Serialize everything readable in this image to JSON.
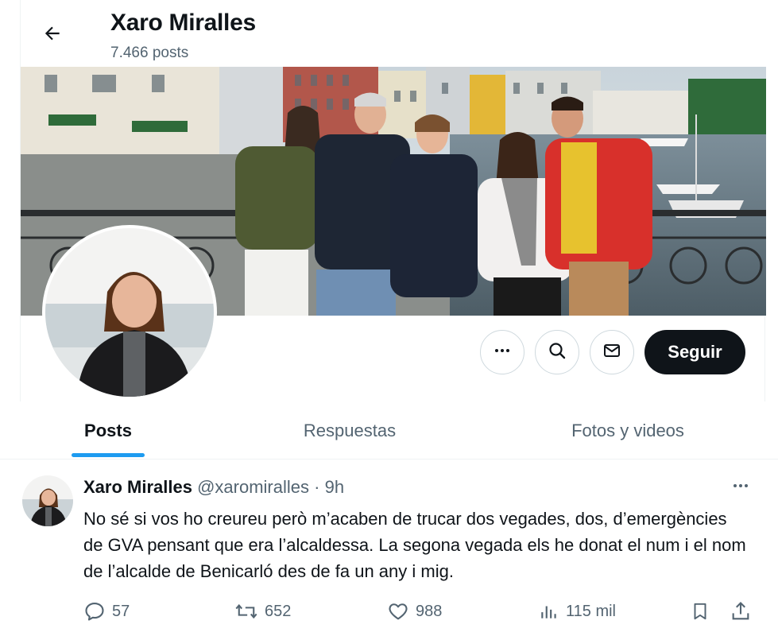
{
  "header": {
    "title": "Xaro Miralles",
    "posts_count": "7.466 posts"
  },
  "profile": {
    "follow_label": "Seguir",
    "icons": [
      "arrow-left-icon",
      "more-dots-icon",
      "search-icon",
      "mail-icon"
    ]
  },
  "tabs": [
    {
      "label": "Posts",
      "active": true
    },
    {
      "label": "Respuestas",
      "active": false
    },
    {
      "label": "Fotos y videos",
      "active": false
    }
  ],
  "post": {
    "name": "Xaro Miralles",
    "handle": "@xaromiralles",
    "separator": "·",
    "time": "9h",
    "text": "No sé si vos ho creureu però m’acaben de trucar dos vegades, dos, d’emergències de GVA pensant que era l’alcaldessa. La segona vegada els he donat el num i el nom de l’alcalde de Benicarló des de fa un any i mig.",
    "metrics": {
      "replies": "57",
      "reposts": "652",
      "likes": "988",
      "views": "115 mil"
    }
  },
  "colors": {
    "accent": "#1d9bf0",
    "text": "#0f1419",
    "secondary": "#536471",
    "border": "#cfd9de"
  }
}
